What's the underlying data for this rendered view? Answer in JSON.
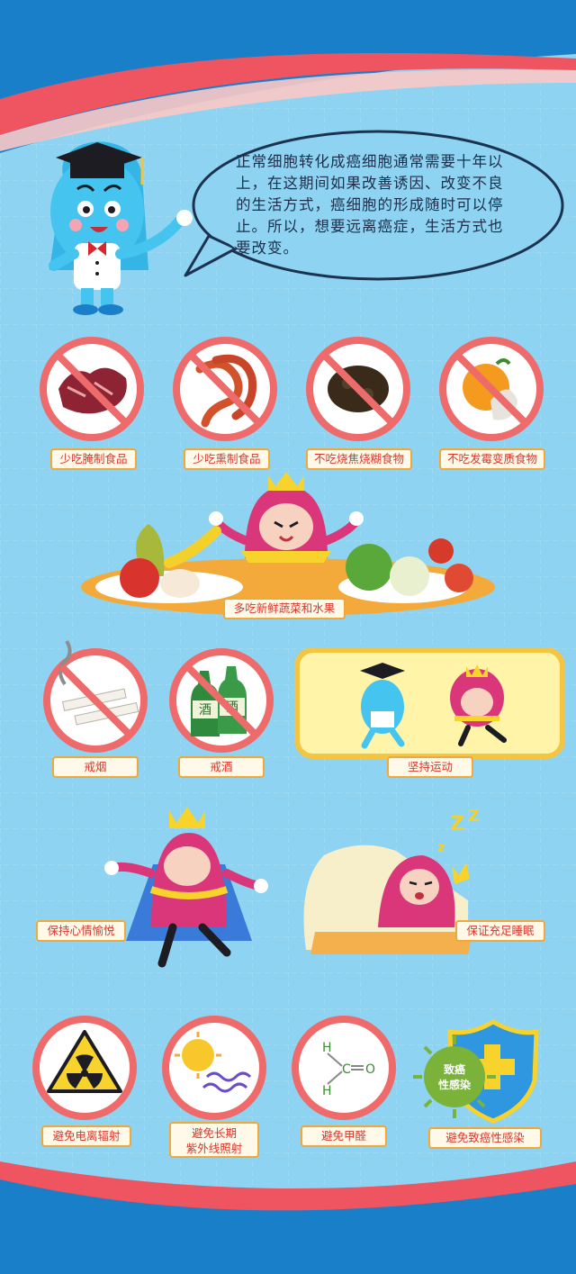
{
  "intro": {
    "line1": "正常细胞转化成癌细胞通常需要十年以",
    "line2": "上，在这期间如果改善诱因、改变不良",
    "line3": "的生活方式，癌细胞的形成随时可以停",
    "line4": "止。所以，想要远离癌症，生活方式也",
    "line5": "要改变。"
  },
  "diet": {
    "cured": "少吃腌制食品",
    "smoked": "少吃熏制食品",
    "burnt": "不吃烧焦烧糊食物",
    "moldy": "不吃发霉变质食物",
    "fresh": "多吃新鲜蔬菜和水果"
  },
  "habits": {
    "no_smoking": "戒烟",
    "no_drinking": "戒酒",
    "exercise": "坚持运动",
    "happy": "保持心情愉悦",
    "sleep": "保证充足睡眠"
  },
  "avoid": {
    "radiation": "避免电离辐射",
    "uv_line1": "避免长期",
    "uv_line2": "紫外线照射",
    "formaldehyde": "避免甲醛",
    "infection": "避免致癌性感染"
  },
  "icons": {
    "formaldehyde_atoms": [
      "H",
      "C",
      "O",
      "H"
    ],
    "bottle_char": "酒",
    "shield_text_line1": "致癌",
    "shield_text_line2": "性感染",
    "sleep_z": [
      "Z",
      "Z",
      "z"
    ]
  },
  "colors": {
    "background": "#8ed3f1",
    "accent_red": "#ee5560",
    "ban_ring": "#ef6a6a",
    "label_border": "#f2a73b",
    "label_text": "#d9372a",
    "exercise_panel": "#fff4a8"
  }
}
